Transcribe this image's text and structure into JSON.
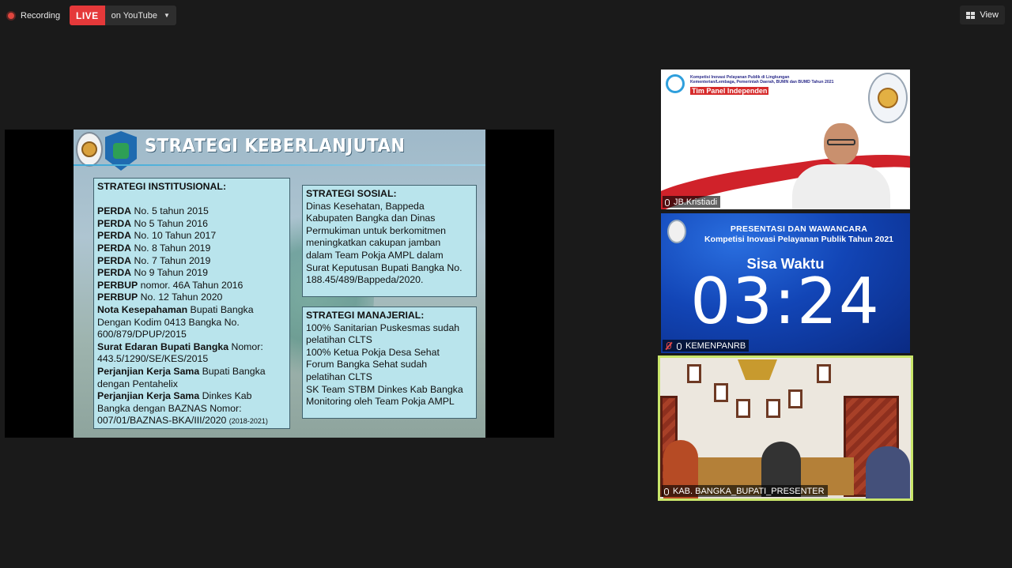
{
  "topbar": {
    "recording_label": "Recording",
    "live_label": "LIVE",
    "live_destination": "on YouTube",
    "view_label": "View"
  },
  "slide": {
    "title": "STRATEGI KEBERLANJUTAN",
    "institutional": {
      "heading": "STRATEGI INSTITUSIONAL:",
      "lines": [
        {
          "bold": "PERDA",
          "text": " No. 5 tahun 2015"
        },
        {
          "bold": "PERDA",
          "text": " No 5 Tahun 2016"
        },
        {
          "bold": "PERDA",
          "text": " No. 10 Tahun 2017"
        },
        {
          "bold": "PERDA",
          "text": " No. 8 Tahun 2019"
        },
        {
          "bold": "PERDA",
          "text": " No. 7 Tahun 2019"
        },
        {
          "bold": "PERDA",
          "text": " No 9 Tahun 2019"
        },
        {
          "bold": "PERBUP",
          "text": " nomor. 46A Tahun 2016"
        },
        {
          "bold": "PERBUP",
          "text": " No. 12 Tahun 2020"
        },
        {
          "bold": "Nota Kesepahaman",
          "text": " Bupati Bangka"
        },
        {
          "bold": "",
          "text": "Dengan Kodim 0413 Bangka No."
        },
        {
          "bold": "",
          "text": "600/879/DPUP/2015"
        },
        {
          "bold": "Surat Edaran Bupati Bangka",
          "text": " Nomor:"
        },
        {
          "bold": "",
          "text": "443.5/1290/SE/KES/2015"
        },
        {
          "bold": "Perjanjian Kerja Sama",
          "text": " Bupati Bangka"
        },
        {
          "bold": "",
          "text": "dengan Pentahelix"
        },
        {
          "bold": "Perjanjian Kerja Sama",
          "text": " Dinkes Kab"
        },
        {
          "bold": "",
          "text": "Bangka dengan BAZNAS Nomor:"
        }
      ],
      "last_line": "007/01/BAZNAS-BKA/III/2020 ",
      "last_small": "(2018-2021)"
    },
    "social": {
      "heading": "STRATEGI SOSIAL:",
      "lines": [
        "Dinas Kesehatan, Bappeda",
        "Kabupaten Bangka dan Dinas",
        "Permukiman untuk berkomitmen",
        "meningkatkan cakupan jamban",
        "dalam Team Pokja AMPL dalam",
        "Surat Keputusan Bupati Bangka No.",
        "188.45/489/Bappeda/2020."
      ]
    },
    "managerial": {
      "heading": "STRATEGI MANAJERIAL:",
      "lines": [
        "100% Sanitarian Puskesmas sudah",
        "pelatihan CLTS",
        "100% Ketua Pokja Desa Sehat",
        "Forum Bangka Sehat sudah",
        "pelatihan CLTS",
        "SK Team STBM Dinkes Kab Bangka",
        "Monitoring oleh Team Pokja AMPL"
      ]
    }
  },
  "tiles": {
    "panel": {
      "header_lines": [
        "Kompetisi Inovasi Pelayanan Publik di Lingkungan",
        "Kementerian/Lembaga, Pemerintah Daerah, BUMN dan BUMD Tahun 2021"
      ],
      "badge": "Tim Panel Independen",
      "name": "JB.Kristiadi"
    },
    "timer": {
      "title": "PRESENTASI DAN WAWANCARA",
      "subtitle": "Kompetisi Inovasi Pelayanan Publik Tahun 2021",
      "label": "Sisa Waktu",
      "value": "03:24",
      "name": "KEMENPANRB"
    },
    "presenter": {
      "name": "KAB. BANGKA_BUPATI_PRESENTER"
    }
  },
  "colors": {
    "live": "#e5393a",
    "active_speaker_border": "#c9e66a",
    "slide_box": "#b9e4ec"
  }
}
